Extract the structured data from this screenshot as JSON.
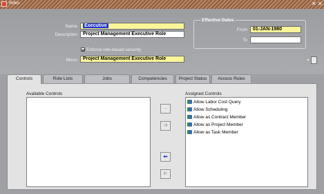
{
  "window": {
    "title": "Roles",
    "controls": "✕ ✕"
  },
  "form": {
    "name_label": "Name",
    "name_value": "Executive",
    "description_label": "Description",
    "description_value": "Project Management Executive Role",
    "enforce_label": "Enforce role-based security",
    "enforce_checked": true,
    "menu_label": "Menu",
    "menu_value": "Project Management Executive Role"
  },
  "effective_dates": {
    "title": "Effective Dates",
    "from_label": "From",
    "from_value": "01-JAN-1980",
    "to_label": "To",
    "to_value": ""
  },
  "tabs": [
    {
      "label": "Controls",
      "active": true
    },
    {
      "label": "Role Lists",
      "active": false
    },
    {
      "label": "Jobs",
      "active": false
    },
    {
      "label": "Competencies",
      "active": false
    },
    {
      "label": "Project Status",
      "active": false
    },
    {
      "label": "Access Rules",
      "active": false
    }
  ],
  "controls_tab": {
    "available_label": "Available Controls",
    "available_items": [],
    "assigned_label": "Assigned Controls",
    "assigned_items": [
      "Allow Labor Cost Query",
      "Allow Scheduling",
      "Allow as Contract Member",
      "Allow as Project Member",
      "Allow as Task Member"
    ],
    "shuttle_buttons": [
      {
        "name": "move-right-button",
        "glyph": "→",
        "enabled": false
      },
      {
        "name": "move-all-right-button",
        "glyph": "⇉",
        "enabled": false
      },
      {
        "name": "move-left-button",
        "glyph": "⬅",
        "enabled": true
      },
      {
        "name": "move-all-left-button",
        "glyph": "⇇",
        "enabled": false
      }
    ]
  },
  "colors": {
    "required_field": "#fbf59a",
    "selection": "#1e34c8",
    "header_bg": "#9fa0a4",
    "panel_bg": "#e3e3e3"
  }
}
